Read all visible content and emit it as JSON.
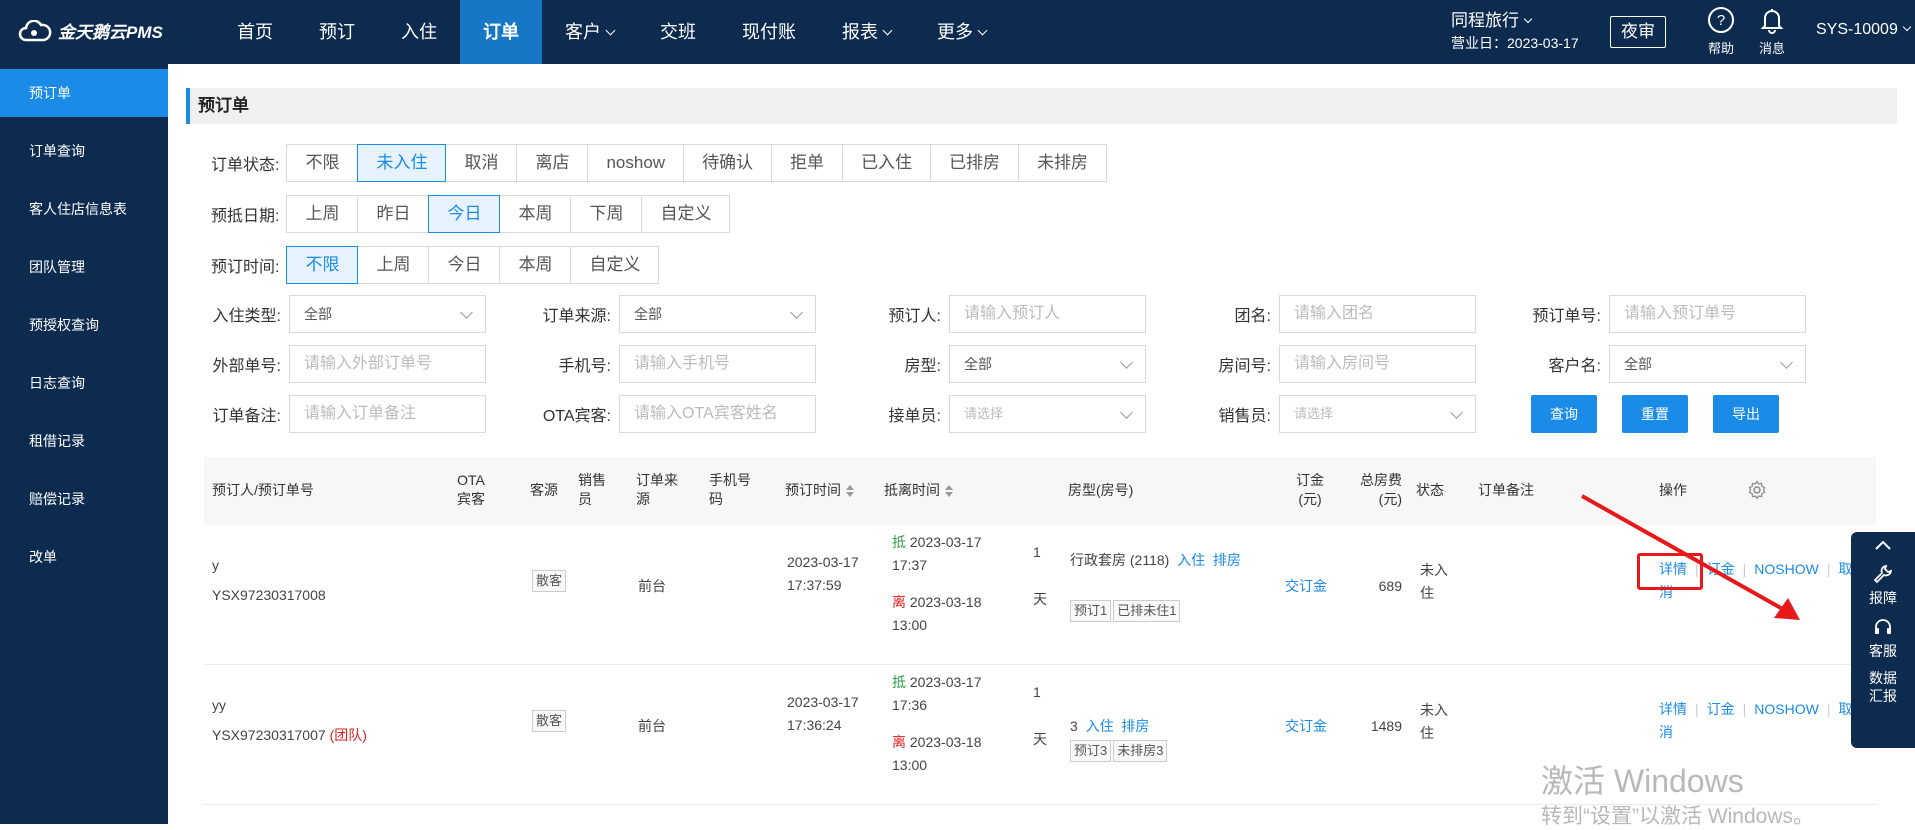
{
  "app": {
    "logo_text": "金天鹅云PMS"
  },
  "nav": [
    {
      "label": "首页"
    },
    {
      "label": "预订"
    },
    {
      "label": "入住"
    },
    {
      "label": "订单"
    },
    {
      "label": "客户"
    },
    {
      "label": "交班"
    },
    {
      "label": "现付账"
    },
    {
      "label": "报表"
    },
    {
      "label": "更多"
    }
  ],
  "hotel": {
    "name": "同程旅行",
    "business_day": "营业日：2023-03-17"
  },
  "header": {
    "night_audit": "夜审",
    "help": "帮助",
    "messages": "消息",
    "user": "SYS-10009"
  },
  "sidebar": [
    {
      "label": "预订单"
    },
    {
      "label": "订单查询"
    },
    {
      "label": "客人住店信息表"
    },
    {
      "label": "团队管理"
    },
    {
      "label": "预授权查询"
    },
    {
      "label": "日志查询"
    },
    {
      "label": "租借记录"
    },
    {
      "label": "赔偿记录"
    },
    {
      "label": "改单"
    }
  ],
  "page_title": "预订单",
  "filters": {
    "status": {
      "label": "订单状态:",
      "options": [
        "不限",
        "未入住",
        "取消",
        "离店",
        "noshow",
        "待确认",
        "拒单",
        "已入住",
        "已排房",
        "未排房"
      ],
      "selected": "未入住"
    },
    "arrive": {
      "label": "预抵日期:",
      "options": [
        "上周",
        "昨日",
        "今日",
        "本周",
        "下周",
        "自定义"
      ],
      "selected": "今日"
    },
    "booktime": {
      "label": "预订时间:",
      "options": [
        "不限",
        "上周",
        "今日",
        "本周",
        "自定义"
      ],
      "selected": "不限"
    }
  },
  "fields": {
    "checkin_type": {
      "label": "入住类型:",
      "value": "全部"
    },
    "order_source": {
      "label": "订单来源:",
      "value": "全部"
    },
    "booker": {
      "label": "预订人:",
      "placeholder": "请输入预订人"
    },
    "group": {
      "label": "团名:",
      "placeholder": "请输入团名"
    },
    "order_no": {
      "label": "预订单号:",
      "placeholder": "请输入预订单号"
    },
    "ext_no": {
      "label": "外部单号:",
      "placeholder": "请输入外部订单号"
    },
    "phone": {
      "label": "手机号:",
      "placeholder": "请输入手机号"
    },
    "room_type": {
      "label": "房型:",
      "value": "全部"
    },
    "room_no": {
      "label": "房间号:",
      "placeholder": "请输入房间号"
    },
    "customer": {
      "label": "客户名:",
      "value": "全部"
    },
    "remark": {
      "label": "订单备注:",
      "placeholder": "请输入订单备注"
    },
    "ota_guest": {
      "label": "OTA宾客:",
      "placeholder": "请输入OTA宾客姓名"
    },
    "receiver": {
      "label": "接单员:",
      "placeholder": "请选择"
    },
    "sales": {
      "label": "销售员:",
      "placeholder": "请选择"
    }
  },
  "buttons": {
    "query": "查询",
    "reset": "重置",
    "export": "导出"
  },
  "table": {
    "headers": {
      "booker": "预订人/预订单号",
      "ota": "OTA宾客",
      "src": "客源",
      "sales": "销售员",
      "order_src": "订单来源",
      "phone": "手机号码",
      "book_time": "预订时间",
      "stay_time": "抵离时间",
      "room": "房型(房号)",
      "deposit": "订金(元)",
      "total": "总房费(元)",
      "status": "状态",
      "remark": "订单备注",
      "ops": "操作"
    },
    "rows": [
      {
        "name": "y",
        "no": "YSX97230317008",
        "group_tag": "",
        "src": "散客",
        "order_src": "前台",
        "book_time": "2023-03-17 17:37:59",
        "arrive_mark": "抵",
        "arrive": "2023-03-17 17:37",
        "leave_mark": "离",
        "leave": "2023-03-18 13:00",
        "nights": "1",
        "nights_unit": "天",
        "room": "行政套房 (2118)",
        "act_checkin": "入住",
        "act_assign": "排房",
        "tag1": "预订1",
        "tag2": "已排未住1",
        "deposit": "交订金",
        "total": "689",
        "status": "未入住",
        "op_detail": "详情",
        "op_deposit": "订金",
        "op_noshow": "NOSHOW",
        "op_cancel": "取消"
      },
      {
        "name": "yy",
        "no": "YSX97230317007",
        "group_tag": "(团队)",
        "src": "散客",
        "order_src": "前台",
        "book_time": "2023-03-17 17:36:24",
        "arrive_mark": "抵",
        "arrive": "2023-03-17 17:36",
        "leave_mark": "离",
        "leave": "2023-03-18 13:00",
        "nights": "1",
        "nights_unit": "天",
        "room": "3",
        "act_checkin": "入住",
        "act_assign": "排房",
        "tag1": "预订3",
        "tag2": "未排房3",
        "deposit": "交订金",
        "total": "1489",
        "status": "未入住",
        "op_detail": "详情",
        "op_deposit": "订金",
        "op_noshow": "NOSHOW",
        "op_cancel": "取消"
      }
    ]
  },
  "float_panel": {
    "report": "报障",
    "service": "客服",
    "data": "数据汇报"
  },
  "watermark": {
    "line1": "激活 Windows",
    "line2": "转到“设置”以激活 Windows。"
  }
}
